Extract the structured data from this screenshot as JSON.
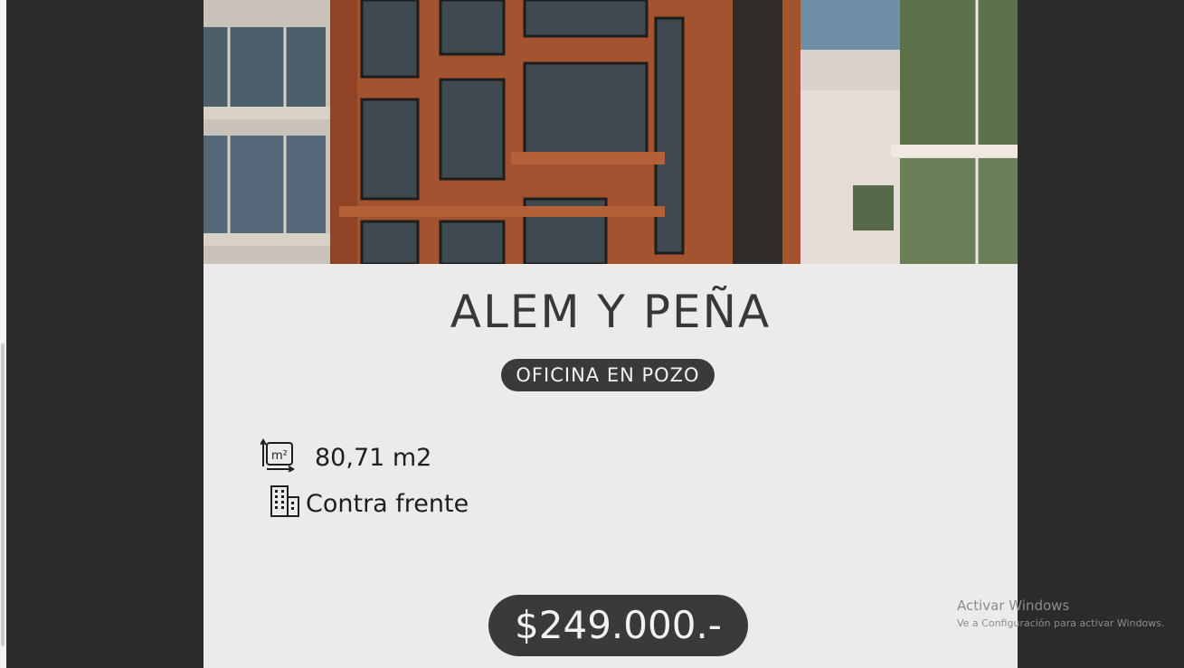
{
  "listing": {
    "title": "ALEM Y PEÑA",
    "tag": "OFICINA EN POZO",
    "features": [
      {
        "icon": "area-m2-icon",
        "label": "80,71 m2"
      },
      {
        "icon": "building-icon",
        "label": "Contra frente"
      }
    ],
    "price": "$249.000.-",
    "hero_image": "brick-building-facade-photo"
  },
  "watermark": {
    "title": "Activar Windows",
    "subtitle": "Ve a Configuración para activar Windows."
  },
  "colors": {
    "background": "#2b2b2b",
    "card": "#edebe9",
    "pill": "#3b3a39",
    "text": "#3a3836"
  }
}
